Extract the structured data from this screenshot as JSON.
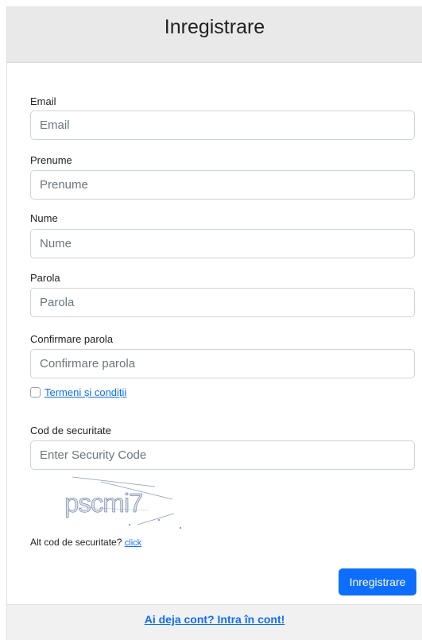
{
  "header": {
    "title": "Inregistrare"
  },
  "fields": {
    "email": {
      "label": "Email",
      "placeholder": "Email",
      "value": ""
    },
    "prenume": {
      "label": "Prenume",
      "placeholder": "Prenume",
      "value": ""
    },
    "nume": {
      "label": "Nume",
      "placeholder": "Nume",
      "value": ""
    },
    "parola": {
      "label": "Parola",
      "placeholder": "Parola",
      "value": ""
    },
    "confirmare": {
      "label": "Confirmare parola",
      "placeholder": "Confirmare parola",
      "value": ""
    },
    "cod": {
      "label": "Cod de securitate",
      "placeholder": "Enter Security Code",
      "value": ""
    }
  },
  "terms": {
    "label": "Termeni și condiții",
    "checked": false
  },
  "captcha": {
    "text": "pscmi7"
  },
  "alt_code": {
    "label": "Alt cod de securitate?",
    "link": "click"
  },
  "submit": {
    "label": "Inregistrare",
    "color": "#0d6efd"
  },
  "footer": {
    "link": "Ai deja cont? Intra în cont!"
  }
}
